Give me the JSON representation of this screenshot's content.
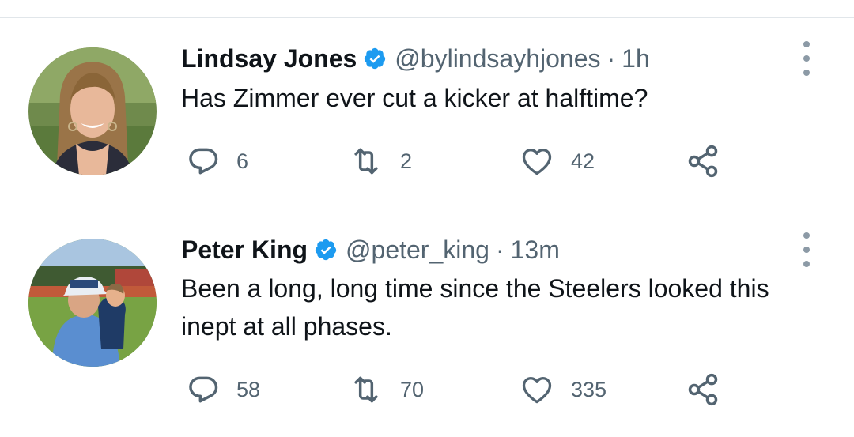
{
  "tweets": [
    {
      "author": "Lindsay Jones",
      "handle": "@bylindsayhjones",
      "separator": "·",
      "time": "1h",
      "text": "Has Zimmer ever cut a kicker at halftime?",
      "replies": "6",
      "retweets": "2",
      "likes": "42",
      "verified": true
    },
    {
      "author": "Peter King",
      "handle": "@peter_king",
      "separator": "·",
      "time": "13m",
      "text": "Been a long, long time since the Steelers looked this inept at all phases.",
      "replies": "58",
      "retweets": "70",
      "likes": "335",
      "verified": true
    }
  ],
  "icons": {
    "reply": "reply-icon",
    "retweet": "retweet-icon",
    "like": "heart-icon",
    "share": "share-icon",
    "more": "more-options-icon",
    "verified": "verified-badge-icon"
  },
  "colors": {
    "text": "#0f1419",
    "secondary": "#536471",
    "verified": "#1d9bf0",
    "divider": "#e1e6ea"
  }
}
